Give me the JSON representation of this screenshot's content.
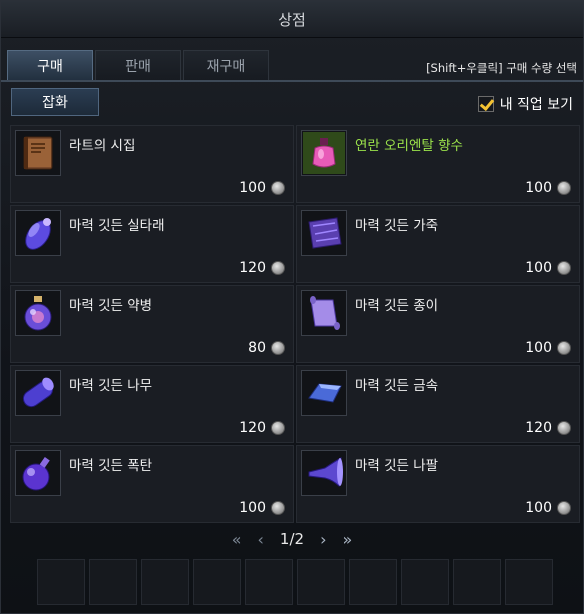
{
  "window": {
    "title": "상점"
  },
  "tabs": [
    {
      "label": "구매",
      "active": true
    },
    {
      "label": "판매",
      "active": false
    },
    {
      "label": "재구매",
      "active": false
    }
  ],
  "hint": "[Shift+우클릭] 구매 수량 선택",
  "filter": {
    "category_label": "잡화"
  },
  "my_job": {
    "label": "내 직업 보기",
    "checked": true
  },
  "items": [
    {
      "name": "라트의 시집",
      "price": "100",
      "icon": "book-icon"
    },
    {
      "name": "연란 오리엔탈 향수",
      "price": "100",
      "icon": "perfume-icon",
      "highlight": "#9be24b"
    },
    {
      "name": "마력 깃든 실타래",
      "price": "120",
      "icon": "thread-spool-icon"
    },
    {
      "name": "마력 깃든 가죽",
      "price": "100",
      "icon": "leather-icon"
    },
    {
      "name": "마력 깃든 약병",
      "price": "80",
      "icon": "potion-bottle-icon"
    },
    {
      "name": "마력 깃든 종이",
      "price": "100",
      "icon": "paper-scroll-icon"
    },
    {
      "name": "마력 깃든 나무",
      "price": "120",
      "icon": "wood-log-icon"
    },
    {
      "name": "마력 깃든 금속",
      "price": "120",
      "icon": "metal-ingot-icon"
    },
    {
      "name": "마력 깃든 폭탄",
      "price": "100",
      "icon": "bomb-icon"
    },
    {
      "name": "마력 깃든 나팔",
      "price": "100",
      "icon": "horn-icon"
    }
  ],
  "pagination": {
    "text": "1/2"
  },
  "currency_icon": "silver-coin-icon",
  "bag_slots": 10
}
